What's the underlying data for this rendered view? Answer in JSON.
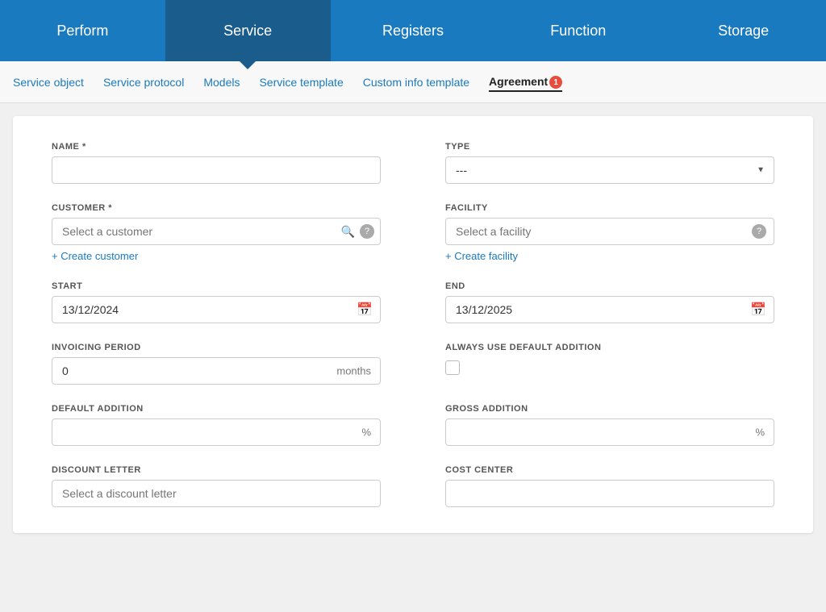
{
  "topNav": {
    "items": [
      {
        "id": "perform",
        "label": "Perform",
        "active": false
      },
      {
        "id": "service",
        "label": "Service",
        "active": true
      },
      {
        "id": "registers",
        "label": "Registers",
        "active": false
      },
      {
        "id": "function",
        "label": "Function",
        "active": false
      },
      {
        "id": "storage",
        "label": "Storage",
        "active": false
      }
    ]
  },
  "subNav": {
    "items": [
      {
        "id": "service-object",
        "label": "Service object",
        "active": false
      },
      {
        "id": "service-protocol",
        "label": "Service protocol",
        "active": false
      },
      {
        "id": "models",
        "label": "Models",
        "active": false
      },
      {
        "id": "service-template",
        "label": "Service template",
        "active": false
      },
      {
        "id": "custom-info-template",
        "label": "Custom info template",
        "active": false
      },
      {
        "id": "agreement",
        "label": "Agreement",
        "active": true,
        "badge": "1"
      }
    ]
  },
  "form": {
    "nameLabel": "NAME *",
    "namePlaceholder": "",
    "typeLabel": "TYPE",
    "typeDefault": "---",
    "customerLabel": "CUSTOMER *",
    "customerPlaceholder": "Select a customer",
    "createCustomerLabel": "+ Create customer",
    "facilityLabel": "FACILITY",
    "facilityPlaceholder": "Select a facility",
    "createFacilityLabel": "+ Create facility",
    "startLabel": "START",
    "startValue": "13/12/2024",
    "endLabel": "END",
    "endValue": "13/12/2025",
    "invoicingPeriodLabel": "INVOICING PERIOD",
    "invoicingPeriodValue": "0",
    "invoicingPeriodSuffix": "months",
    "alwaysUseDefaultAdditionLabel": "ALWAYS USE DEFAULT ADDITION",
    "defaultAdditionLabel": "DEFAULT ADDITION",
    "defaultAdditionSuffix": "%",
    "grossAdditionLabel": "GROSS ADDITION",
    "grossAdditionSuffix": "%",
    "discountLetterLabel": "DISCOUNT LETTER",
    "discountLetterPlaceholder": "Select a discount letter",
    "costCenterLabel": "COST CENTER",
    "costCenterValue": ""
  }
}
